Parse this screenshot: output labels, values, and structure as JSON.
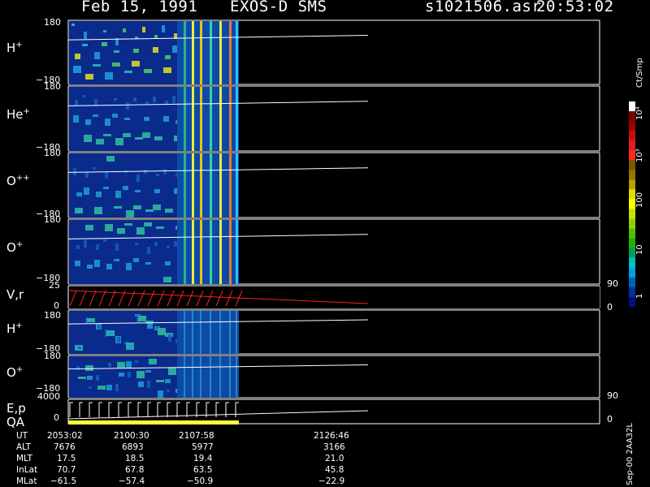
{
  "header": {
    "date": "Feb 15, 1991",
    "instrument": "EXOS-D SMS",
    "file": "s1021506.asr",
    "time": "20:53:02"
  },
  "panels": [
    {
      "label": "H",
      "sup": "+",
      "ymax": "180",
      "ymin": "−180"
    },
    {
      "label": "He",
      "sup": "+",
      "ymax": "180",
      "ymin": "−180"
    },
    {
      "label": "O",
      "sup": "++",
      "ymax": "180",
      "ymin": "−180"
    },
    {
      "label": "O",
      "sup": "+",
      "ymax": "180",
      "ymin": "−180"
    },
    {
      "label": "V,r",
      "sup": "",
      "ymax": "25",
      "ymin": "0",
      "right_max": "90",
      "right_min": "0"
    },
    {
      "label": "H",
      "sup": "+",
      "ymax": "180",
      "ymin": "−180"
    },
    {
      "label": "O",
      "sup": "+",
      "ymax": "180",
      "ymin": "−180"
    },
    {
      "label": "E,p",
      "sup": "",
      "ymax": "4000",
      "ymin": "0",
      "right_max": "90",
      "right_min": "0"
    }
  ],
  "qa_label": "QA",
  "colorbar": {
    "units": "Ct/Smp",
    "ticks": [
      "10⁴",
      "10³",
      "100",
      "10",
      "1"
    ],
    "colors": [
      "#ffffff",
      "#7a0000",
      "#a00000",
      "#c81010",
      "#e02020",
      "#ff2a1a",
      "#7a5a00",
      "#8c7a00",
      "#b4a000",
      "#e0e000",
      "#ffff00",
      "#c8e000",
      "#90d000",
      "#50c000",
      "#20b000",
      "#00a060",
      "#00c0c0",
      "#00a0e0",
      "#0060c0",
      "#0030a0",
      "#001080"
    ]
  },
  "footer_code": "Sep-00  2AA32L",
  "orbit_table": {
    "labels": [
      "UT",
      "ALT",
      "MLT",
      "InLat",
      "MLat"
    ],
    "columns": [
      [
        "2053:02",
        "7676",
        "17.5",
        "70.7",
        "−61.5"
      ],
      [
        "2100:30",
        "6893",
        "18.5",
        "67.8",
        "−57.4"
      ],
      [
        "2107:58",
        "5977",
        "19.4",
        "63.5",
        "−50.9"
      ],
      [
        "2126:46",
        "3166",
        "21.0",
        "45.8",
        "−22.9"
      ]
    ]
  },
  "colors": {
    "background": "#000000",
    "panel_fill": "#0a2a8c",
    "trace_white": "#ffffff",
    "trace_red": "#ff2020",
    "qa_yellow": "#ffff40"
  }
}
